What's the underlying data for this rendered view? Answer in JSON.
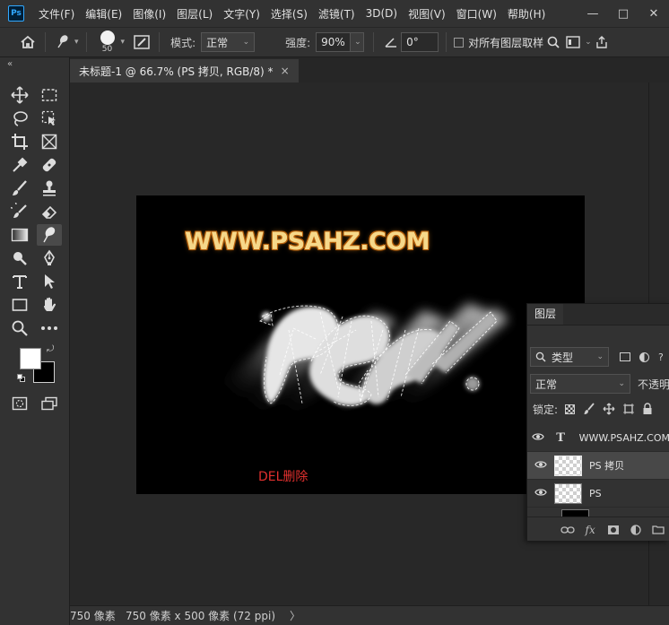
{
  "app": {
    "logo": "Ps",
    "menu": [
      "文件(F)",
      "编辑(E)",
      "图像(I)",
      "图层(L)",
      "文字(Y)",
      "选择(S)",
      "滤镜(T)",
      "3D(D)",
      "视图(V)",
      "窗口(W)",
      "帮助(H)"
    ],
    "window_controls": [
      "—",
      "□",
      "✕"
    ]
  },
  "options": {
    "brush_size": "50",
    "mode_label": "模式:",
    "mode_value": "正常",
    "strength_label": "强度:",
    "strength_value": "90%",
    "angle_value": "0°",
    "sample_all_label": "对所有图层取样"
  },
  "document": {
    "tab_title": "未标题-1 @ 66.7% (PS 拷贝, RGB/8) *",
    "tab_close": "×",
    "watermark": "WWW.PSAHZ.COM",
    "annotation": "DEL删除",
    "annotation_color": "#e0302e"
  },
  "toolbar": {
    "collapse": "«",
    "foreground_color": "#ffffff",
    "background_color": "#000000"
  },
  "layers_panel": {
    "tab": "图层",
    "filter_label": "类型",
    "blend_mode": "正常",
    "opacity_label": "不透明",
    "lock_label": "锁定:",
    "layers": [
      {
        "name": "WWW.PSAHZ.COM",
        "kind": "text",
        "selected": false
      },
      {
        "name": "PS 拷贝",
        "kind": "pixel",
        "selected": true
      },
      {
        "name": "PS",
        "kind": "pixel",
        "selected": false
      }
    ]
  },
  "status": {
    "zoom": "750 像素",
    "doc_size": "750 像素 x 500 像素 (72 ppi)",
    "arrow": "〉"
  }
}
